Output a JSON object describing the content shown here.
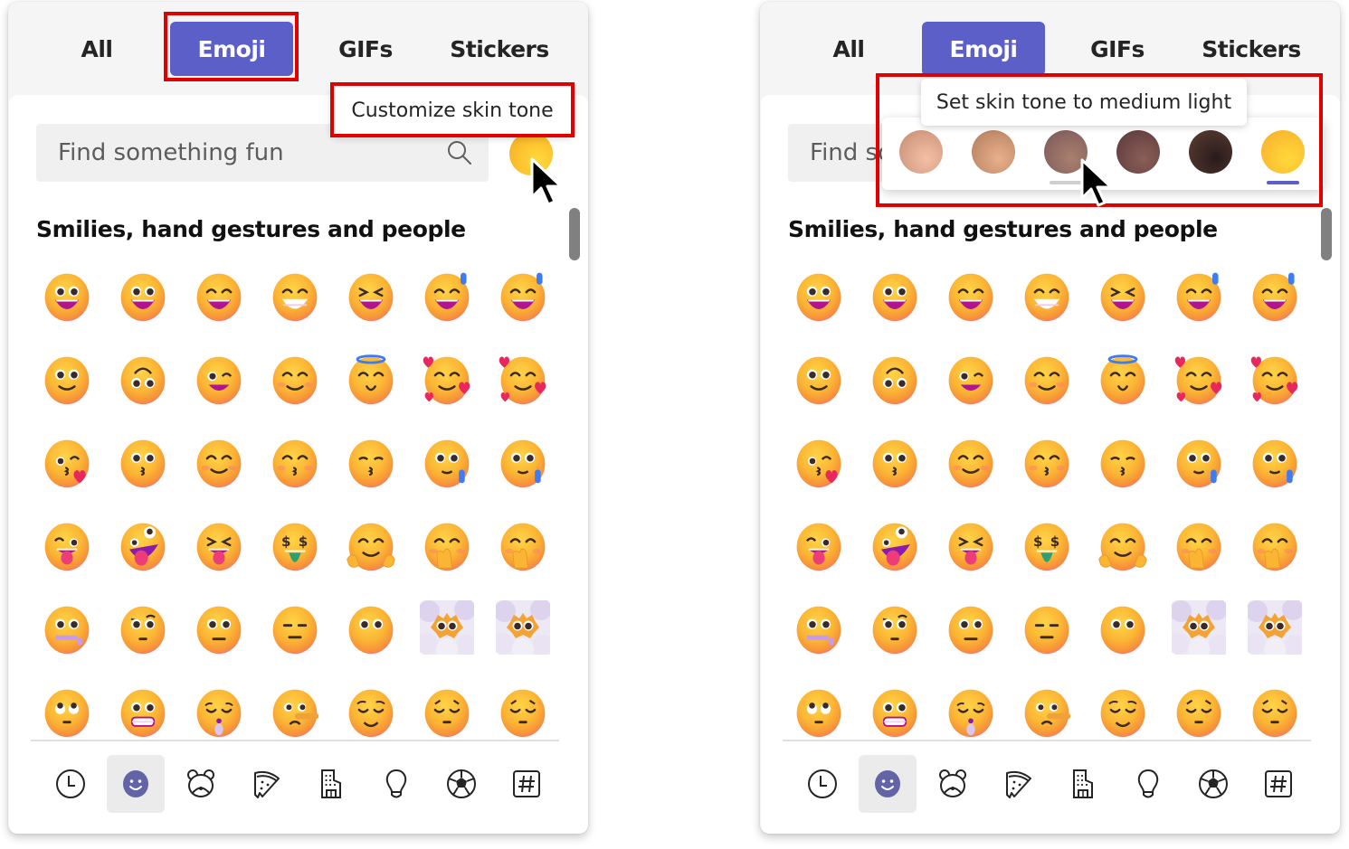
{
  "tabs": [
    {
      "label": "All",
      "active": false
    },
    {
      "label": "Emoji",
      "active": true
    },
    {
      "label": "GIFs",
      "active": false
    },
    {
      "label": "Stickers",
      "active": false
    }
  ],
  "search": {
    "placeholder": "Find something fun",
    "value": "",
    "icon": "search-icon"
  },
  "section_title": "Smilies, hand gestures and people",
  "emoji_rows": [
    [
      "grinning-face-big-eyes",
      "grinning-face-big-eyes",
      "grinning-face-smiling-eyes",
      "beaming-face",
      "grinning-squinting-face",
      "grinning-face-sweat",
      "grinning-face-sweat"
    ],
    [
      "slightly-smiling-face",
      "upside-down-face",
      "winking-face",
      "smiling-face-smiling-eyes",
      "smiling-face-halo",
      "smiling-face-hearts",
      "smiling-face-hearts"
    ],
    [
      "face-blowing-kiss",
      "kissing-face",
      "smiling-face",
      "kissing-face-smiling-eyes",
      "kissing-face-closed-eyes",
      "smiling-face-tear",
      "smiling-face-tear"
    ],
    [
      "winking-face-tongue",
      "zany-face",
      "squinting-face-tongue",
      "money-mouth-face",
      "hugging-face",
      "face-hand-over-mouth",
      "face-hand-over-mouth"
    ],
    [
      "zipper-mouth-face",
      "face-raised-eyebrow",
      "neutral-face",
      "expressionless-face",
      "face-without-mouth",
      "face-in-clouds",
      "face-in-clouds"
    ],
    [
      "face-rolling-eyes",
      "grimacing-face",
      "face-exhaling",
      "lying-face",
      "relieved-face",
      "pensive-face",
      "pensive-face"
    ]
  ],
  "categories": [
    {
      "name": "recent",
      "icon": "clock-icon",
      "active": false
    },
    {
      "name": "smilies",
      "icon": "smiley-icon",
      "active": true
    },
    {
      "name": "animals",
      "icon": "bear-icon",
      "active": false
    },
    {
      "name": "food",
      "icon": "pizza-icon",
      "active": false
    },
    {
      "name": "travel",
      "icon": "building-icon",
      "active": false
    },
    {
      "name": "objects",
      "icon": "lightbulb-icon",
      "active": false
    },
    {
      "name": "activities",
      "icon": "soccer-ball-icon",
      "active": false
    },
    {
      "name": "symbols",
      "icon": "hashtag-icon",
      "active": false
    }
  ],
  "left_panel": {
    "tooltip": "Customize skin tone",
    "skin_tone_button": "default-yellow"
  },
  "right_panel": {
    "tooltip": "Set skin tone to medium light",
    "skin_tones": [
      {
        "name": "light",
        "color_a": "#f3c0a6",
        "color_b": "#c48a72",
        "hovered": false,
        "selected": false
      },
      {
        "name": "medium-light",
        "color_a": "#e8b08a",
        "color_b": "#b07a5c",
        "hovered": false,
        "selected": false
      },
      {
        "name": "medium",
        "color_a": "#a9806e",
        "color_b": "#7a5658",
        "hovered": true,
        "selected": false
      },
      {
        "name": "medium-dark",
        "color_a": "#8a5e58",
        "color_b": "#5a3838",
        "hovered": false,
        "selected": false
      },
      {
        "name": "dark",
        "color_a": "#2a1a1c",
        "color_b": "#5c4034",
        "hovered": false,
        "selected": false
      },
      {
        "name": "default",
        "color_a": "#ffd93c",
        "color_b": "#f8ac2a",
        "hovered": false,
        "selected": true
      }
    ]
  },
  "colors": {
    "accent": "#5b5fc7",
    "highlight": "#e00000",
    "hover_underline": "#cfcfcf"
  }
}
